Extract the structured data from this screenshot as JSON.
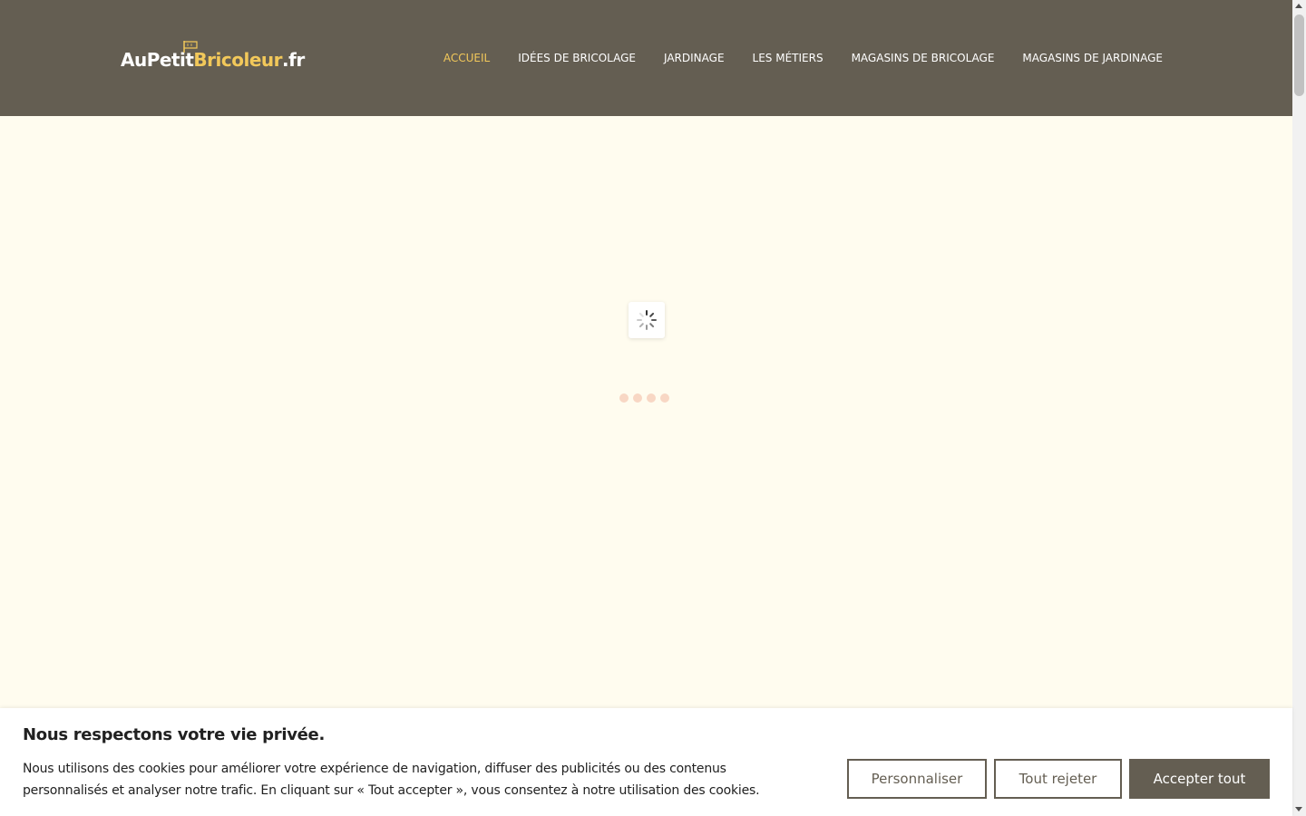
{
  "header": {
    "logo": {
      "part1": "AuPetit",
      "part2": "Bricoleur",
      "part3": ".fr"
    },
    "nav": [
      {
        "label": "ACCUEIL",
        "active": true
      },
      {
        "label": "IDÉES DE BRICOLAGE",
        "active": false
      },
      {
        "label": "JARDINAGE",
        "active": false
      },
      {
        "label": "LES MÉTIERS",
        "active": false
      },
      {
        "label": "MAGASINS DE BRICOLAGE",
        "active": false
      },
      {
        "label": "MAGASINS DE JARDINAGE",
        "active": false
      }
    ]
  },
  "main": {
    "loading_icon": "spinner-icon",
    "loading_dots": 4
  },
  "cookie": {
    "title": "Nous respectons votre vie privée.",
    "text": "Nous utilisons des cookies pour améliorer votre expérience de navigation, diffuser des publicités ou des contenus personnalisés et analyser notre trafic. En cliquant sur « Tout accepter », vous consentez à notre utilisation des cookies.",
    "buttons": {
      "customize": "Personnaliser",
      "reject": "Tout rejeter",
      "accept": "Accepter tout"
    }
  },
  "colors": {
    "header_bg": "#645e52",
    "accent": "#f2c85a",
    "page_bg": "#fffcef",
    "loader_dots": "#f8d7c4"
  }
}
